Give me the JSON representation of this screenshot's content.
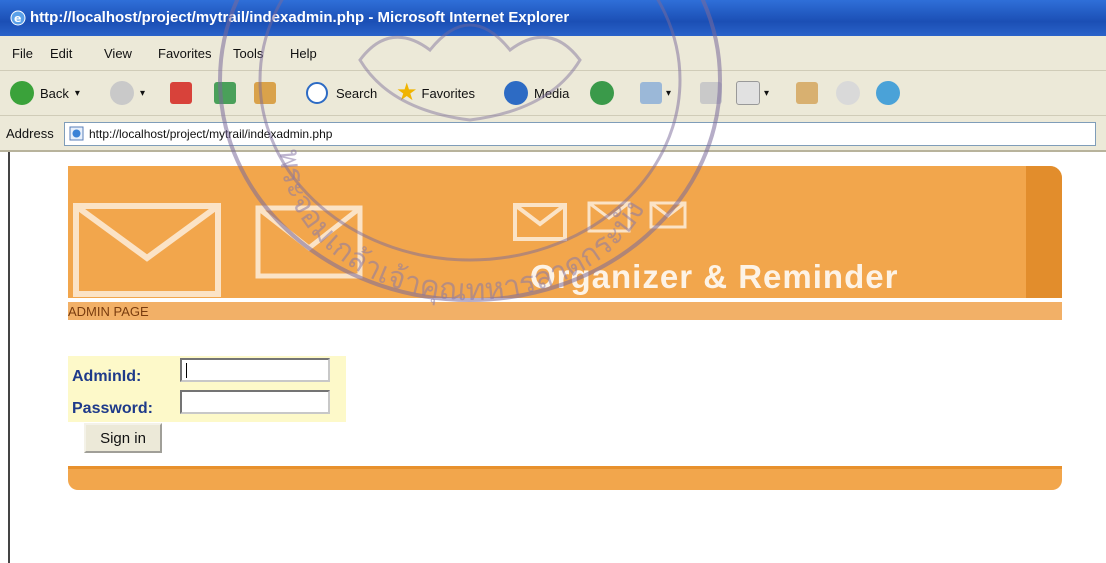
{
  "window": {
    "title": "http://localhost/project/mytrail/indexadmin.php - Microsoft Internet Explorer"
  },
  "menu": {
    "items": [
      "File",
      "Edit",
      "View",
      "Favorites",
      "Tools",
      "Help"
    ]
  },
  "toolbar": {
    "back_label": "Back",
    "search_label": "Search",
    "favorites_label": "Favorites",
    "media_label": "Media"
  },
  "address": {
    "label": "Address",
    "url": "http://localhost/project/mytrail/indexadmin.php"
  },
  "page": {
    "banner_title": "Organizer & Reminder",
    "admin_label": "ADMIN PAGE",
    "login": {
      "admin_label": "AdminId:",
      "password_label": "Password:",
      "admin_value": "",
      "password_value": "",
      "signin_label": "Sign in"
    }
  },
  "watermark": {
    "text": "พระจอมเกล้าเจ้าคุณทหารลาดกระบัง"
  },
  "colors": {
    "banner_orange": "#f2a64c",
    "titlebar_blue": "#1b4fb5",
    "login_bg": "#fdf9c9",
    "label_blue": "#1e3a8a"
  }
}
